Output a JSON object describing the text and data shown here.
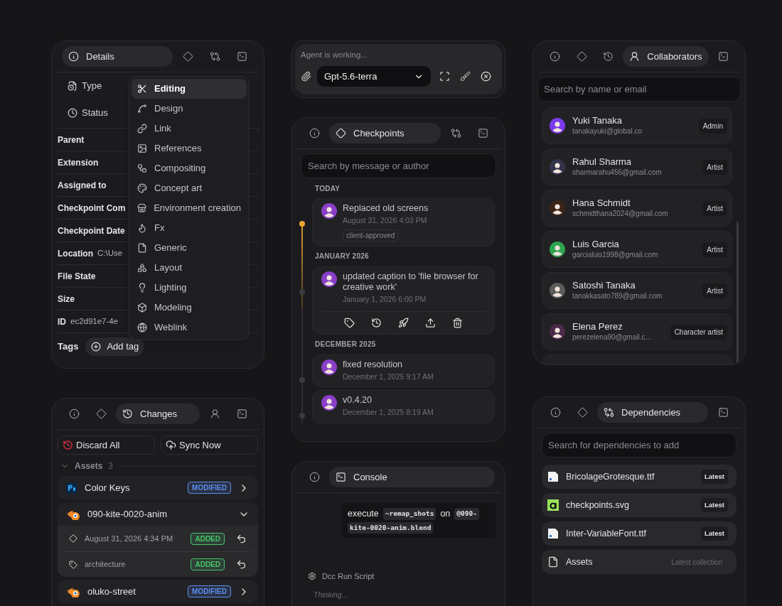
{
  "details": {
    "tabs": [
      {
        "kind": "details",
        "label": "Details",
        "selected": true
      },
      {
        "kind": "checkpoints",
        "selected": false
      },
      {
        "kind": "dependencies",
        "selected": false
      },
      {
        "kind": "console",
        "selected": false
      }
    ],
    "fields": [
      {
        "kind": "type",
        "label": "Type"
      },
      {
        "kind": "status",
        "label": "Status"
      }
    ],
    "rows": [
      {
        "label": "Parent"
      },
      {
        "label": "Extension"
      },
      {
        "label": "Assigned to"
      },
      {
        "label": "Checkpoint Com"
      },
      {
        "label": "Checkpoint Date"
      },
      {
        "label": "Location",
        "value": "C:\\Use"
      },
      {
        "label": "File State"
      },
      {
        "label": "Size"
      },
      {
        "label": "ID",
        "value": "ec2d91e7-4e"
      }
    ],
    "tags_label": "Tags",
    "add_tag": "Add tag",
    "menu": [
      {
        "label": "Editing",
        "selected": true
      },
      {
        "label": "Design",
        "selected": false
      },
      {
        "label": "Link",
        "selected": false
      },
      {
        "label": "References",
        "selected": false
      },
      {
        "label": "Compositing",
        "selected": false
      },
      {
        "label": "Concept art",
        "selected": false
      },
      {
        "label": "Environment creation",
        "selected": false
      },
      {
        "label": "Fx",
        "selected": false
      },
      {
        "label": "Generic",
        "selected": false
      },
      {
        "label": "Layout",
        "selected": false
      },
      {
        "label": "Lighting",
        "selected": false
      },
      {
        "label": "Modeling",
        "selected": false
      },
      {
        "label": "Weblink",
        "selected": false
      }
    ]
  },
  "changes": {
    "tabs": [
      {
        "kind": "details",
        "selected": false
      },
      {
        "kind": "checkpoints",
        "selected": false
      },
      {
        "kind": "changes",
        "label": "Changes",
        "selected": true
      },
      {
        "kind": "collaborators",
        "selected": false
      },
      {
        "kind": "console",
        "selected": false
      }
    ],
    "discard": "Discard All",
    "sync": "Sync Now",
    "section": {
      "label": "Assets",
      "count": "3",
      "expanded": true
    },
    "items": [
      {
        "kind": "photoshop",
        "name": "Color Keys",
        "badge": "MODIFIED",
        "color": "#5b8def",
        "expanded": false
      },
      {
        "kind": "blender",
        "name": "090-kite-0020-anim",
        "expanded": true,
        "children": [
          {
            "kind": "checkpoint",
            "label": "August 31, 2026 4:34 PM",
            "badge": "ADDED",
            "color": "#47c46b"
          },
          {
            "kind": "tag",
            "label": "architecture",
            "badge": "ADDED",
            "color": "#47c46b"
          }
        ]
      },
      {
        "kind": "blender",
        "name": "oluko-street",
        "badge": "MODIFIED",
        "color": "#5b8def",
        "expanded": false
      }
    ]
  },
  "agent": {
    "placeholder": "Agent is working...",
    "model": "Gpt-5.6-terra"
  },
  "checkpoints": {
    "tabs": [
      {
        "kind": "details",
        "selected": false
      },
      {
        "kind": "checkpoints",
        "label": "Checkpoints",
        "selected": true
      },
      {
        "kind": "dependencies",
        "selected": false
      },
      {
        "kind": "console",
        "selected": false
      }
    ],
    "placeholder": "Search by message or author",
    "groups": [
      {
        "label": "TODAY",
        "entries": [
          {
            "message": "Replaced old screens",
            "date": "August 31, 2026 4:03 PM",
            "tag": "client-approved",
            "current": true,
            "expanded": false
          }
        ]
      },
      {
        "label": "JANUARY 2026",
        "entries": [
          {
            "message": "updated caption to 'file browser for creative work'",
            "date": "January 1, 2026 6:00 PM",
            "current": false,
            "expanded": true
          }
        ]
      },
      {
        "label": "DECEMBER 2025",
        "entries": [
          {
            "message": "fixed resolution",
            "date": "December 1, 2025 9:17 AM",
            "current": false,
            "expanded": false
          },
          {
            "message": "v0.4.20",
            "date": "December 1, 2025 8:19 AM",
            "current": false,
            "expanded": false
          }
        ]
      }
    ]
  },
  "console": {
    "tabs": [
      {
        "kind": "details",
        "selected": false
      },
      {
        "kind": "console",
        "label": "Console",
        "selected": true
      }
    ],
    "message": [
      {
        "kind": "text",
        "text": "execute"
      },
      {
        "kind": "code",
        "text": "~remap_shots"
      },
      {
        "kind": "text",
        "text": "on"
      },
      {
        "kind": "code",
        "text": "@090-"
      },
      {
        "kind": "code",
        "text": "kite-0020-anim.blend"
      }
    ],
    "tool": "Dcc Run Script",
    "status": "Thinking..."
  },
  "collaborators": {
    "tabs": [
      {
        "kind": "details",
        "selected": false
      },
      {
        "kind": "checkpoints",
        "selected": false
      },
      {
        "kind": "changes",
        "selected": false
      },
      {
        "kind": "collaborators",
        "label": "Collaborators",
        "selected": true
      },
      {
        "kind": "console",
        "selected": false
      }
    ],
    "placeholder": "Search by name or email",
    "people": [
      {
        "name": "Yuki Tanaka",
        "email": "tanakayuki@global.co",
        "role": "Admin",
        "color": "#7c3aed"
      },
      {
        "name": "Rahul Sharma",
        "email": "sharmarahu456@gmail.com",
        "role": "Artist",
        "color": "#33334a"
      },
      {
        "name": "Hana Schmidt",
        "email": "schmidthana2024@gmail.com",
        "role": "Artist",
        "color": "#3b2417"
      },
      {
        "name": "Luis Garcia",
        "email": "garcialuis1998@gmail.com",
        "role": "Artist",
        "color": "#2ea44f"
      },
      {
        "name": "Satoshi Tanaka",
        "email": "tanakkasato789@gmail.com",
        "role": "Artist",
        "color": "#5b5b5b"
      },
      {
        "name": "Elena Perez",
        "email": "perezelena90@gmail.c...",
        "role": "Character artist",
        "color": "#4a2a48"
      }
    ]
  },
  "dependencies": {
    "tabs": [
      {
        "kind": "details",
        "selected": false
      },
      {
        "kind": "checkpoints",
        "selected": false
      },
      {
        "kind": "dependencies",
        "label": "Dependencies",
        "selected": true
      },
      {
        "kind": "console",
        "selected": false
      }
    ],
    "placeholder": "Search for dependencies to add",
    "items": [
      {
        "kind": "font",
        "name": "BricolageGrotesque.ttf",
        "version": "Latest"
      },
      {
        "kind": "svg",
        "name": "checkpoints.svg",
        "version": "Latest"
      },
      {
        "kind": "font",
        "name": "Inter-VariableFont.ttf",
        "version": "Latest"
      },
      {
        "kind": "collection",
        "name": "Assets",
        "version": "Latest collection"
      }
    ]
  }
}
